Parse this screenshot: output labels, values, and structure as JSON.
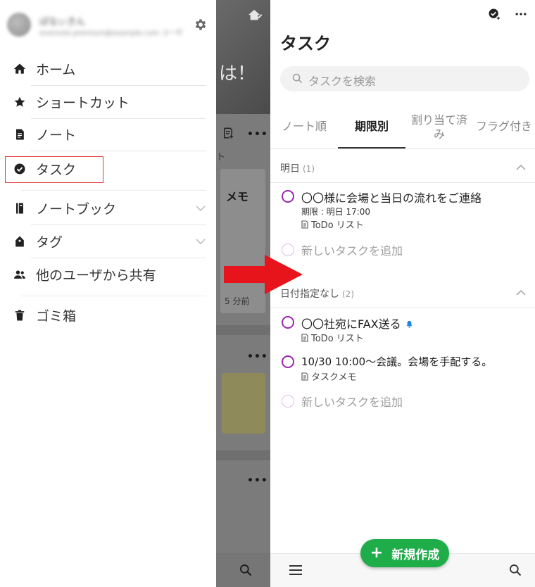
{
  "drawer": {
    "account_name": "ぱなぃきん",
    "account_email": "evernote.premium@example.com ユーザ",
    "items": [
      {
        "label": "ホーム",
        "icon": "home-icon"
      },
      {
        "label": "ショートカット",
        "icon": "star-icon"
      },
      {
        "label": "ノート",
        "icon": "note-icon"
      },
      {
        "label": "タスク",
        "icon": "check-circle-icon"
      },
      {
        "label": "ノートブック",
        "icon": "notebook-icon"
      },
      {
        "label": "タグ",
        "icon": "tag-icon"
      },
      {
        "label": "他のユーザから共有",
        "icon": "people-icon"
      },
      {
        "label": "ゴミ箱",
        "icon": "trash-icon"
      }
    ]
  },
  "background": {
    "photo_text": "は！",
    "t_fragment": "ト",
    "memo_label": "メモ",
    "time_ago": "5 分前",
    "dots": "•••"
  },
  "panel": {
    "title": "タスク",
    "search_placeholder": "タスクを検索",
    "tabs": [
      "ノート順",
      "期限別",
      "割り当て済み",
      "フラグ付き"
    ],
    "active_tab": "期限別",
    "sections": [
      {
        "title": "明日",
        "count": "(1)",
        "tasks": [
          {
            "title": "〇〇様に会場と当日の流れをご連絡",
            "due": "期限 : 明日 17:00",
            "note": "ToDo リスト"
          }
        ]
      },
      {
        "title": "日付指定なし",
        "count": "(2)",
        "tasks": [
          {
            "title": "〇〇社宛にFAX送る",
            "note": "ToDo リスト",
            "reminder": true
          },
          {
            "title": "10/30 10:00〜会議。会場を手配する。",
            "note": "タスクメモ"
          }
        ]
      }
    ],
    "add_task_label": "新しいタスクを追加",
    "new_button_label": "新規作成",
    "new_button_plus": "+"
  },
  "colors": {
    "accent_green": "#1fad4a",
    "task_circle": "#9c27b0",
    "highlight_red": "#e53935",
    "arrow_red": "#e8141c"
  }
}
